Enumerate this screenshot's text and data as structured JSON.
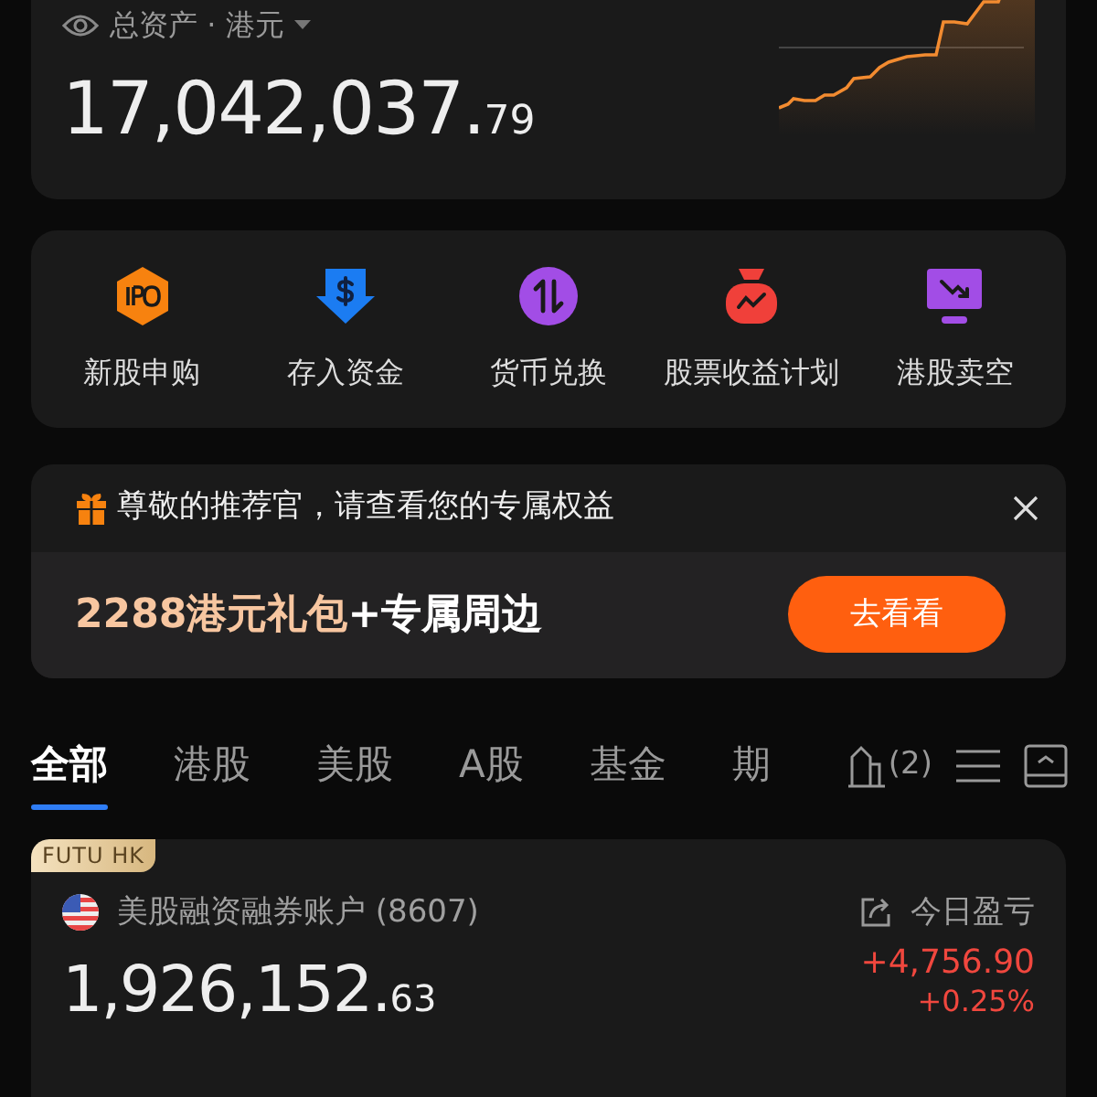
{
  "summary": {
    "label": "总资产 · 港元",
    "amount_main": "17,042,037.",
    "amount_decimal": "79"
  },
  "shortcuts": [
    {
      "kind": "ipo",
      "label": "新股申购"
    },
    {
      "kind": "deposit",
      "label": "存入资金"
    },
    {
      "kind": "exchange",
      "label": "货币兑换"
    },
    {
      "kind": "plan",
      "label": "股票收益计划"
    },
    {
      "kind": "short",
      "label": "港股卖空"
    }
  ],
  "promo": {
    "title": "尊敬的推荐官，请查看您的专属权益",
    "highlight": "2288港元礼包",
    "rest": "+专属周边",
    "button": "去看看"
  },
  "tabs": [
    {
      "label": "全部",
      "selected": true
    },
    {
      "label": "港股",
      "selected": false
    },
    {
      "label": "美股",
      "selected": false
    },
    {
      "label": "A股",
      "selected": false
    },
    {
      "label": "基金",
      "selected": false
    },
    {
      "label": "期",
      "selected": false
    }
  ],
  "bank_count": "(2)",
  "account": {
    "badge": "FUTU HK",
    "name": "美股融资融券账户 (8607)",
    "amount_main": "1,926,152.",
    "amount_decimal": "63",
    "pnl_label": "今日盈亏",
    "pnl": "+4,756.90",
    "pnl_pct": "+0.25%"
  }
}
